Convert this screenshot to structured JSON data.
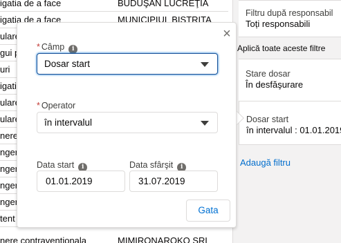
{
  "table": {
    "rows": [
      {
        "c1": "igatia de a face",
        "c2": "BUDUŞAN LUCREŢIA"
      },
      {
        "c1": "igatia de a face",
        "c2": "MUNICIPIUL BISTRITA"
      },
      {
        "c1": "ulare",
        "c2": ""
      },
      {
        "c1": "gui pe",
        "c2": ""
      },
      {
        "c1": "uri",
        "c2": ""
      },
      {
        "c1": "igati",
        "c2": ""
      },
      {
        "c1": "ulare",
        "c2": ""
      },
      {
        "c1": "ulare",
        "c2": ""
      },
      {
        "c1": "nere",
        "c2": ""
      },
      {
        "c1": "ngere",
        "c2": ""
      },
      {
        "c1": "ngere",
        "c2": ""
      },
      {
        "c1": "ngere",
        "c2": ""
      },
      {
        "c1": "ngere",
        "c2": ""
      },
      {
        "c1": "tent",
        "c2": ""
      },
      {
        "c1": "nere contraventionala",
        "c2": "MIMIRONAROKO SRL"
      }
    ]
  },
  "filters": {
    "owner_title": "Filtru după responsabil",
    "owner_value": "Toți responsabili",
    "apply_all": "Aplică toate aceste filtre",
    "status_title": "Stare dosar",
    "status_value": "În desfăşurare",
    "start_title": "Dosar start",
    "start_value": "în intervalul : 01.01.2019",
    "add_filter": "Adaugă filtru"
  },
  "popover": {
    "close_glyph": "×",
    "field_label": "Câmp",
    "field_value": "Dosar start",
    "operator_label": "Operator",
    "operator_value": "în intervalul",
    "start_label": "Data start",
    "start_value": "01.01.2019",
    "end_label": "Data sfârşit",
    "end_value": "31.07.2019",
    "done_label": "Gata",
    "required_mark": "*",
    "info_glyph": "i"
  }
}
